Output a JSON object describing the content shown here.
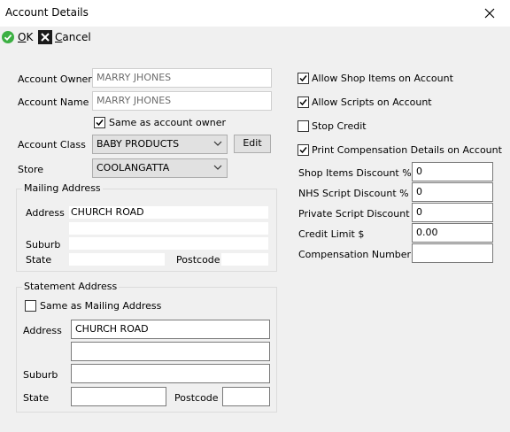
{
  "window": {
    "title": "Account Details"
  },
  "toolbar": {
    "ok": {
      "accel": "O",
      "rest": "K"
    },
    "cancel": {
      "accel": "C",
      "rest": "ancel"
    }
  },
  "account": {
    "owner_label": "Account Owner",
    "owner_value": "MARRY JHONES",
    "name_label": "Account Name",
    "name_value": "MARRY JHONES",
    "same_as_owner_label": "Same as account owner",
    "same_as_owner_checked": true,
    "class_label": "Account Class",
    "class_value": "BABY PRODUCTS",
    "edit_label": "Edit",
    "store_label": "Store",
    "store_value": "COOLANGATTA"
  },
  "mailing": {
    "legend": "Mailing Address",
    "address_label": "Address",
    "address_line1": "CHURCH ROAD",
    "address_line2": "",
    "suburb_label": "Suburb",
    "suburb_value": "",
    "state_label": "State",
    "state_value": "",
    "postcode_label": "Postcode",
    "postcode_value": ""
  },
  "statement": {
    "legend": "Statement Address",
    "same_as_mailing_label": "Same as Mailing Address",
    "same_as_mailing_checked": false,
    "address_label": "Address",
    "address_line1": "CHURCH ROAD",
    "address_line2": "",
    "suburb_label": "Suburb",
    "suburb_value": "",
    "state_label": "State",
    "state_value": "",
    "postcode_label": "Postcode",
    "postcode_value": ""
  },
  "options": {
    "allow_shop_items": {
      "label": "Allow Shop Items on Account",
      "checked": true
    },
    "allow_scripts": {
      "label": "Allow Scripts on Account",
      "checked": true
    },
    "stop_credit": {
      "label": "Stop Credit",
      "checked": false
    },
    "print_compensation": {
      "label": "Print Compensation Details on Account",
      "checked": true
    }
  },
  "discounts": {
    "shop_items_label": "Shop Items Discount %",
    "shop_items_value": "0",
    "nhs_script_label": "NHS Script Discount %",
    "nhs_script_value": "0",
    "private_script_label": "Private Script Discount %",
    "private_script_value": "0",
    "credit_limit_label": "Credit Limit $",
    "credit_limit_value": "0.00",
    "compensation_number_label": "Compensation Number",
    "compensation_number_value": ""
  },
  "colors": {
    "ok_icon": "#3cb043",
    "window_bg": "#f0f0f0"
  },
  "icons": {
    "ok": "check-circle-icon",
    "cancel": "x-box-icon",
    "close": "close-icon",
    "dropdown": "chevron-down-icon"
  }
}
